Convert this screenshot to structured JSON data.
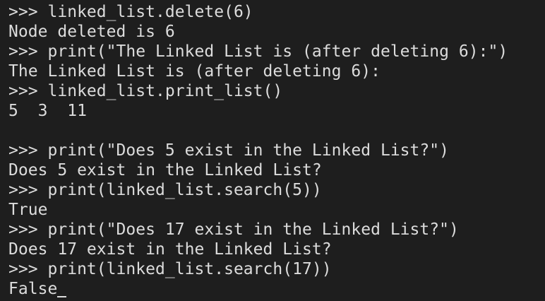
{
  "terminal": {
    "lines": [
      ">>> linked_list.delete(6)",
      "Node deleted is 6",
      ">>> print(\"The Linked List is (after deleting 6):\")",
      "The Linked List is (after deleting 6):",
      ">>> linked_list.print_list()",
      "5  3  11",
      "",
      ">>> print(\"Does 5 exist in the Linked List?\")",
      "Does 5 exist in the Linked List?",
      ">>> print(linked_list.search(5))",
      "True",
      ">>> print(\"Does 17 exist in the Linked List?\")",
      "Does 17 exist in the Linked List?",
      ">>> print(linked_list.search(17))",
      "False"
    ],
    "colors": {
      "background": "#1e1e1e",
      "text": "#dcdcdc"
    }
  }
}
